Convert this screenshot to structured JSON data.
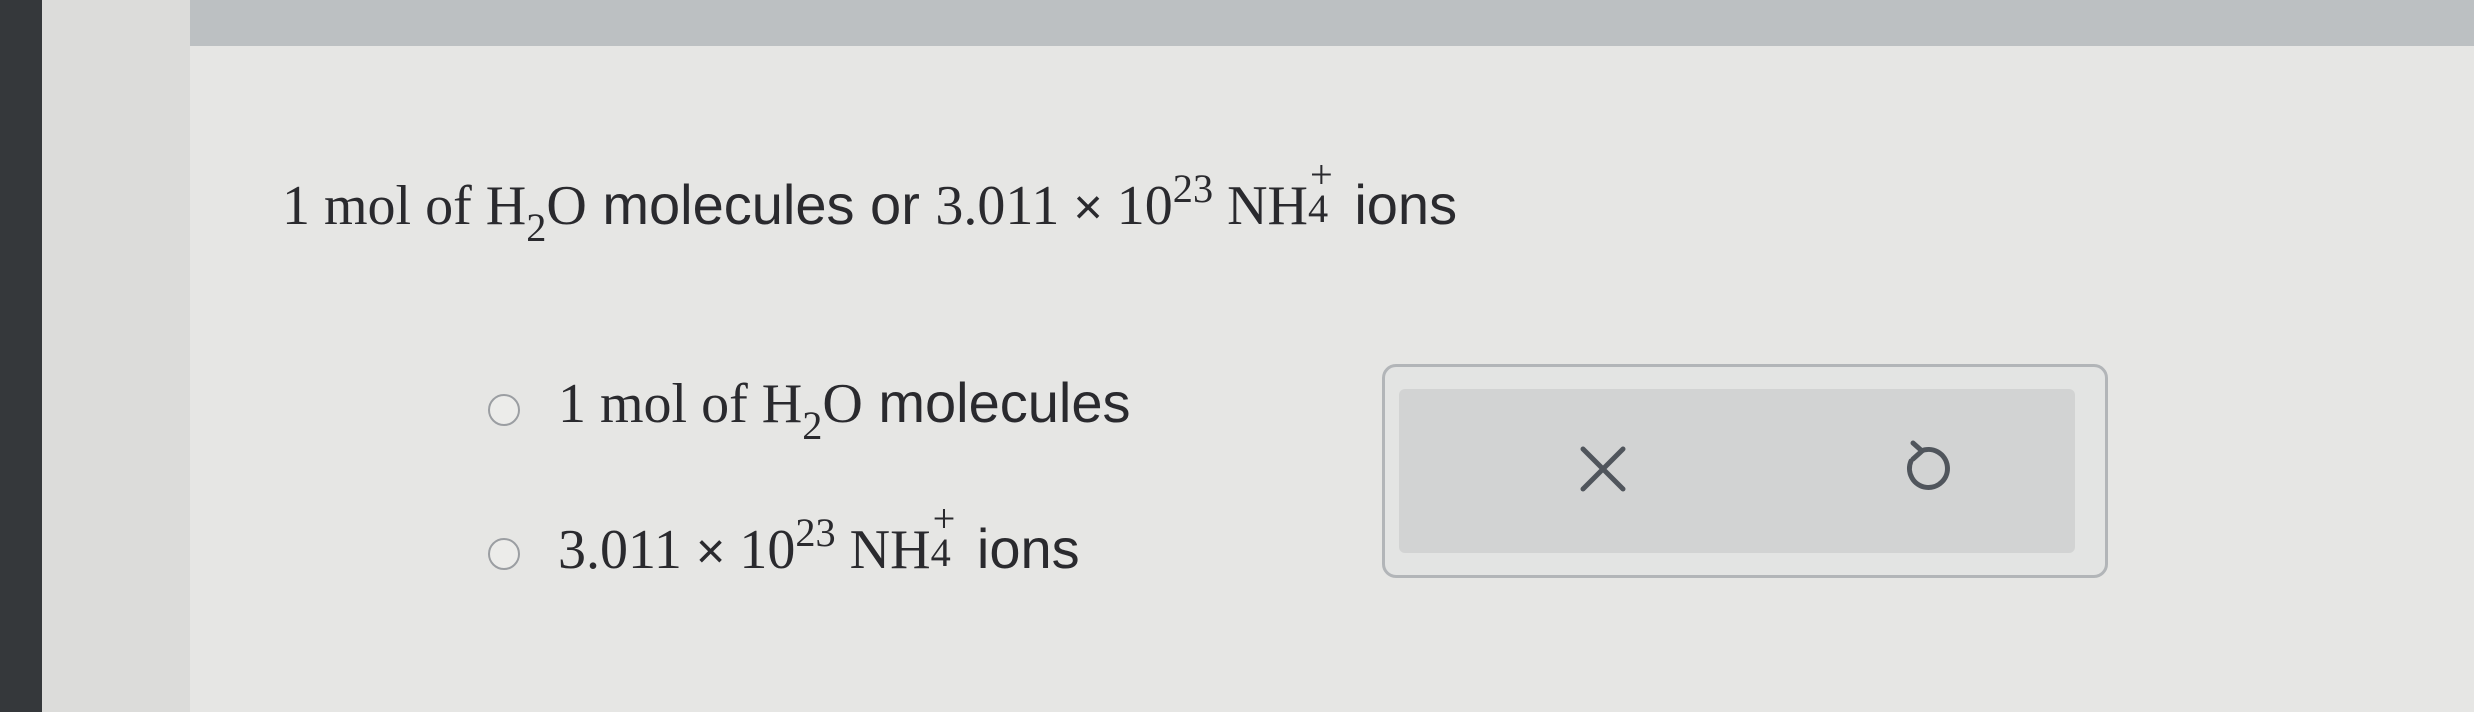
{
  "question": {
    "prefix": "1 mol of H",
    "h2o_sub": "2",
    "h2o_tail": "O",
    "middle": "molecules or",
    "coefficient": "3.011",
    "times": "×",
    "base": "10",
    "exponent": "23",
    "ion": "NH",
    "ion_sub": "4",
    "ion_charge": "+",
    "suffix": "ions"
  },
  "options": [
    {
      "selected": false,
      "prefix": "1 mol of H",
      "sub": "2",
      "tail": "O",
      "word": "molecules"
    },
    {
      "selected": false,
      "coefficient": "3.011",
      "times": "×",
      "base": "10",
      "exponent": "23",
      "ion": "NH",
      "ion_sub": "4",
      "ion_charge": "+",
      "word": "ions"
    }
  ],
  "actions": {
    "clear_icon": "x-icon",
    "undo_icon": "undo-icon"
  },
  "colors": {
    "text": "#2a2a2e",
    "panel_border": "#b2b5b8",
    "icon": "#50555c"
  }
}
